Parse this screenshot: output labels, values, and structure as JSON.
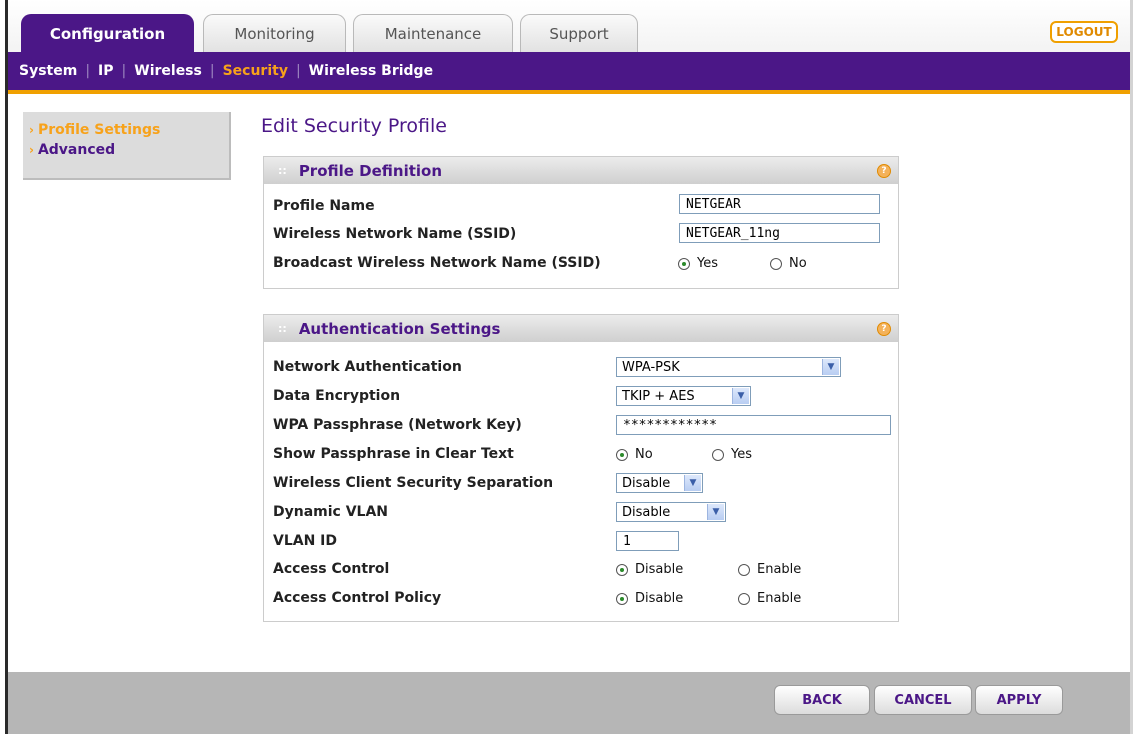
{
  "tabs": [
    {
      "label": "Configuration"
    },
    {
      "label": "Monitoring"
    },
    {
      "label": "Maintenance"
    },
    {
      "label": "Support"
    }
  ],
  "logout_label": "LOGOUT",
  "subnav": [
    {
      "label": "System"
    },
    {
      "label": "IP"
    },
    {
      "label": "Wireless"
    },
    {
      "label": "Security"
    },
    {
      "label": "Wireless Bridge"
    }
  ],
  "leftnav": [
    {
      "label": "Profile Settings"
    },
    {
      "label": "Advanced"
    }
  ],
  "page_title": "Edit Security Profile",
  "profile": {
    "title": "Profile Definition",
    "rows": {
      "profile_name": {
        "label": "Profile Name",
        "value": "NETGEAR"
      },
      "ssid": {
        "label": "Wireless Network Name (SSID)",
        "value": "NETGEAR_11ng"
      },
      "broadcast": {
        "label": "Broadcast Wireless Network Name (SSID)",
        "yes": "Yes",
        "no": "No"
      }
    }
  },
  "auth": {
    "title": "Authentication Settings",
    "rows": {
      "network_auth": {
        "label": "Network Authentication",
        "value": "WPA-PSK"
      },
      "data_enc": {
        "label": "Data Encryption",
        "value": "TKIP + AES"
      },
      "passphrase": {
        "label": "WPA Passphrase (Network Key)",
        "value": "************"
      },
      "show_pass": {
        "label": "Show Passphrase in Clear Text",
        "no": "No",
        "yes": "Yes"
      },
      "separation": {
        "label": "Wireless Client Security Separation",
        "value": "Disable"
      },
      "dynamic_vlan": {
        "label": "Dynamic VLAN",
        "value": "Disable"
      },
      "vlan_id": {
        "label": "VLAN ID",
        "value": "1"
      },
      "access_control": {
        "label": "Access Control",
        "disable": "Disable",
        "enable": "Enable"
      },
      "access_policy": {
        "label": "Access Control Policy",
        "disable": "Disable",
        "enable": "Enable"
      }
    }
  },
  "buttons": {
    "back": "BACK",
    "cancel": "CANCEL",
    "apply": "APPLY"
  },
  "help_label": "?",
  "colors": {
    "brand_purple": "#4b1787",
    "accent_orange": "#f7a21b"
  }
}
